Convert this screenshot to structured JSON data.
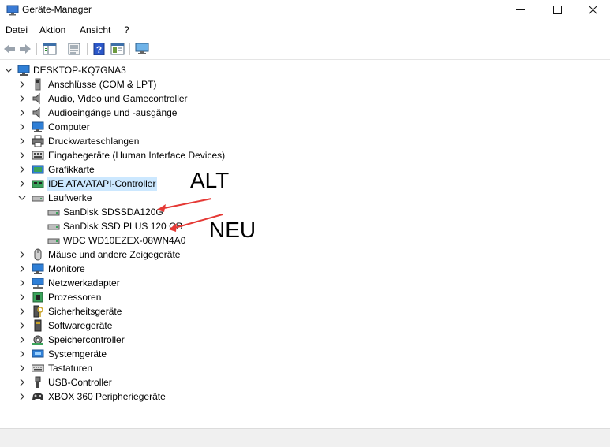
{
  "window": {
    "title": "Geräte-Manager",
    "minimize_glyph": "—",
    "close_glyph": "✕"
  },
  "menu": [
    "Datei",
    "Aktion",
    "Ansicht",
    "?"
  ],
  "toolbar": {
    "icons": [
      "back-icon",
      "forward-icon",
      "show-hide-tree-icon",
      "properties-icon",
      "help-icon",
      "view-icon",
      "monitor-scan-icon"
    ]
  },
  "tree": {
    "root": "DESKTOP-KQ7GNA3",
    "categories": [
      "Anschlüsse (COM & LPT)",
      "Audio, Video und Gamecontroller",
      "Audioeingänge und -ausgänge",
      "Computer",
      "Druckwarteschlangen",
      "Eingabegeräte (Human Interface Devices)",
      "Grafikkarte",
      "IDE ATA/ATAPI-Controller",
      "Laufwerke",
      "Mäuse und andere Zeigegeräte",
      "Monitore",
      "Netzwerkadapter",
      "Prozessoren",
      "Sicherheitsgeräte",
      "Softwaregeräte",
      "Speichercontroller",
      "Systemgeräte",
      "Tastaturen",
      "USB-Controller",
      "XBOX 360 Peripheriegeräte"
    ],
    "drives": [
      "SanDisk SDSSDA120G",
      "SanDisk SSD PLUS 120 GB",
      "WDC WD10EZEX-08WN4A0"
    ]
  },
  "annotations": {
    "alt": "ALT",
    "neu": "NEU",
    "arrow_color": "#e53935"
  },
  "colors": {
    "selection": "#cce8ff"
  }
}
